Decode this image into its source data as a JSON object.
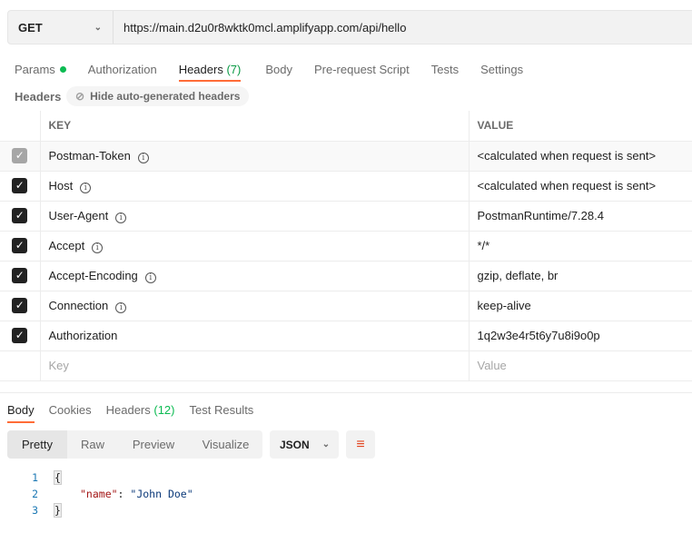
{
  "request": {
    "method": "GET",
    "url": "https://main.d2u0r8wktk0mcl.amplifyapp.com/api/hello"
  },
  "req_tabs": [
    {
      "label": "Params"
    },
    {
      "label": "Authorization"
    },
    {
      "label": "Headers",
      "count": "(7)"
    },
    {
      "label": "Body"
    },
    {
      "label": "Pre-request Script"
    },
    {
      "label": "Tests"
    },
    {
      "label": "Settings"
    }
  ],
  "headers_section": {
    "title": "Headers",
    "hide_button": "Hide auto-generated headers"
  },
  "table": {
    "key_header": "KEY",
    "value_header": "VALUE",
    "rows": [
      {
        "key": "Postman-Token",
        "value": "<calculated when request is sent>",
        "checked": true,
        "disabled": true,
        "info": true
      },
      {
        "key": "Host",
        "value": "<calculated when request is sent>",
        "checked": true,
        "info": true
      },
      {
        "key": "User-Agent",
        "value": "PostmanRuntime/7.28.4",
        "checked": true,
        "info": true
      },
      {
        "key": "Accept",
        "value": "*/*",
        "checked": true,
        "info": true
      },
      {
        "key": "Accept-Encoding",
        "value": "gzip, deflate, br",
        "checked": true,
        "info": true
      },
      {
        "key": "Connection",
        "value": "keep-alive",
        "checked": true,
        "info": true
      },
      {
        "key": "Authorization",
        "value": "1q2w3e4r5t6y7u8i9o0p",
        "checked": true,
        "info": false
      }
    ],
    "key_placeholder": "Key",
    "value_placeholder": "Value"
  },
  "resp_tabs": [
    {
      "label": "Body"
    },
    {
      "label": "Cookies"
    },
    {
      "label": "Headers",
      "count": "(12)"
    },
    {
      "label": "Test Results"
    }
  ],
  "view_modes": [
    "Pretty",
    "Raw",
    "Preview",
    "Visualize"
  ],
  "format": "JSON",
  "code": {
    "lines": [
      "1",
      "2",
      "3"
    ],
    "open": "{",
    "key": "\"name\"",
    "colon": ": ",
    "value": "\"John Doe\"",
    "close": "}"
  },
  "colors": {
    "accent": "#ff6c37",
    "params_dot": "#0cbb52",
    "count_green": "#0cbb52"
  }
}
